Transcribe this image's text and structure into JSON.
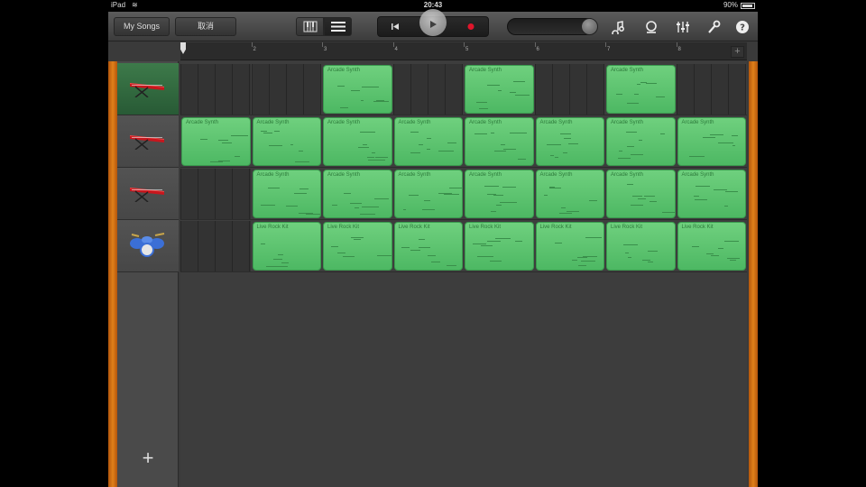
{
  "status": {
    "device": "iPad",
    "time": "20:43",
    "battery": "90%"
  },
  "toolbar": {
    "my_songs": "My Songs",
    "undo": "取消",
    "view_keyboard_icon": "piano-keys-icon",
    "view_tracks_icon": "track-list-icon",
    "rewind_icon": "rewind-icon",
    "play_icon": "play-icon",
    "record_icon": "record-icon",
    "record_color": "#e0152b",
    "master_volume": 0.9,
    "right_icons": [
      "loop-icon",
      "metronome-icon",
      "mixer-icon",
      "settings-wrench-icon",
      "help-icon"
    ]
  },
  "ruler": {
    "bars": [
      "1",
      "2",
      "3",
      "4",
      "5",
      "6",
      "7",
      "8"
    ]
  },
  "tracks": [
    {
      "instrument": "keyboard-synth-icon",
      "selected": true,
      "regions": [
        {
          "bar": 3,
          "label": "Arcade Synth"
        },
        {
          "bar": 5,
          "label": "Arcade Synth"
        },
        {
          "bar": 7,
          "label": "Arcade Synth"
        }
      ]
    },
    {
      "instrument": "keyboard-synth-icon",
      "selected": false,
      "regions": [
        {
          "bar": 1,
          "label": "Arcade Synth"
        },
        {
          "bar": 2,
          "label": "Arcade Synth"
        },
        {
          "bar": 3,
          "label": "Arcade Synth"
        },
        {
          "bar": 4,
          "label": "Arcade Synth"
        },
        {
          "bar": 5,
          "label": "Arcade Synth"
        },
        {
          "bar": 6,
          "label": "Arcade Synth"
        },
        {
          "bar": 7,
          "label": "Arcade Synth"
        },
        {
          "bar": 8,
          "label": "Arcade Synth"
        }
      ]
    },
    {
      "instrument": "keyboard-synth-icon",
      "selected": false,
      "regions": [
        {
          "bar": 2,
          "label": "Arcade Synth"
        },
        {
          "bar": 3,
          "label": "Arcade Synth"
        },
        {
          "bar": 4,
          "label": "Arcade Synth"
        },
        {
          "bar": 5,
          "label": "Arcade Synth"
        },
        {
          "bar": 6,
          "label": "Arcade Synth"
        },
        {
          "bar": 7,
          "label": "Arcade Synth"
        },
        {
          "bar": 8,
          "label": "Arcade Synth"
        }
      ]
    },
    {
      "instrument": "drum-kit-icon",
      "selected": false,
      "regions": [
        {
          "bar": 2,
          "label": "Live Rock Kit"
        },
        {
          "bar": 3,
          "label": "Live Rock Kit"
        },
        {
          "bar": 4,
          "label": "Live Rock Kit"
        },
        {
          "bar": 5,
          "label": "Live Rock Kit"
        },
        {
          "bar": 6,
          "label": "Live Rock Kit"
        },
        {
          "bar": 7,
          "label": "Live Rock Kit"
        },
        {
          "bar": 8,
          "label": "Live Rock Kit"
        }
      ]
    }
  ],
  "add_track_label": "+"
}
